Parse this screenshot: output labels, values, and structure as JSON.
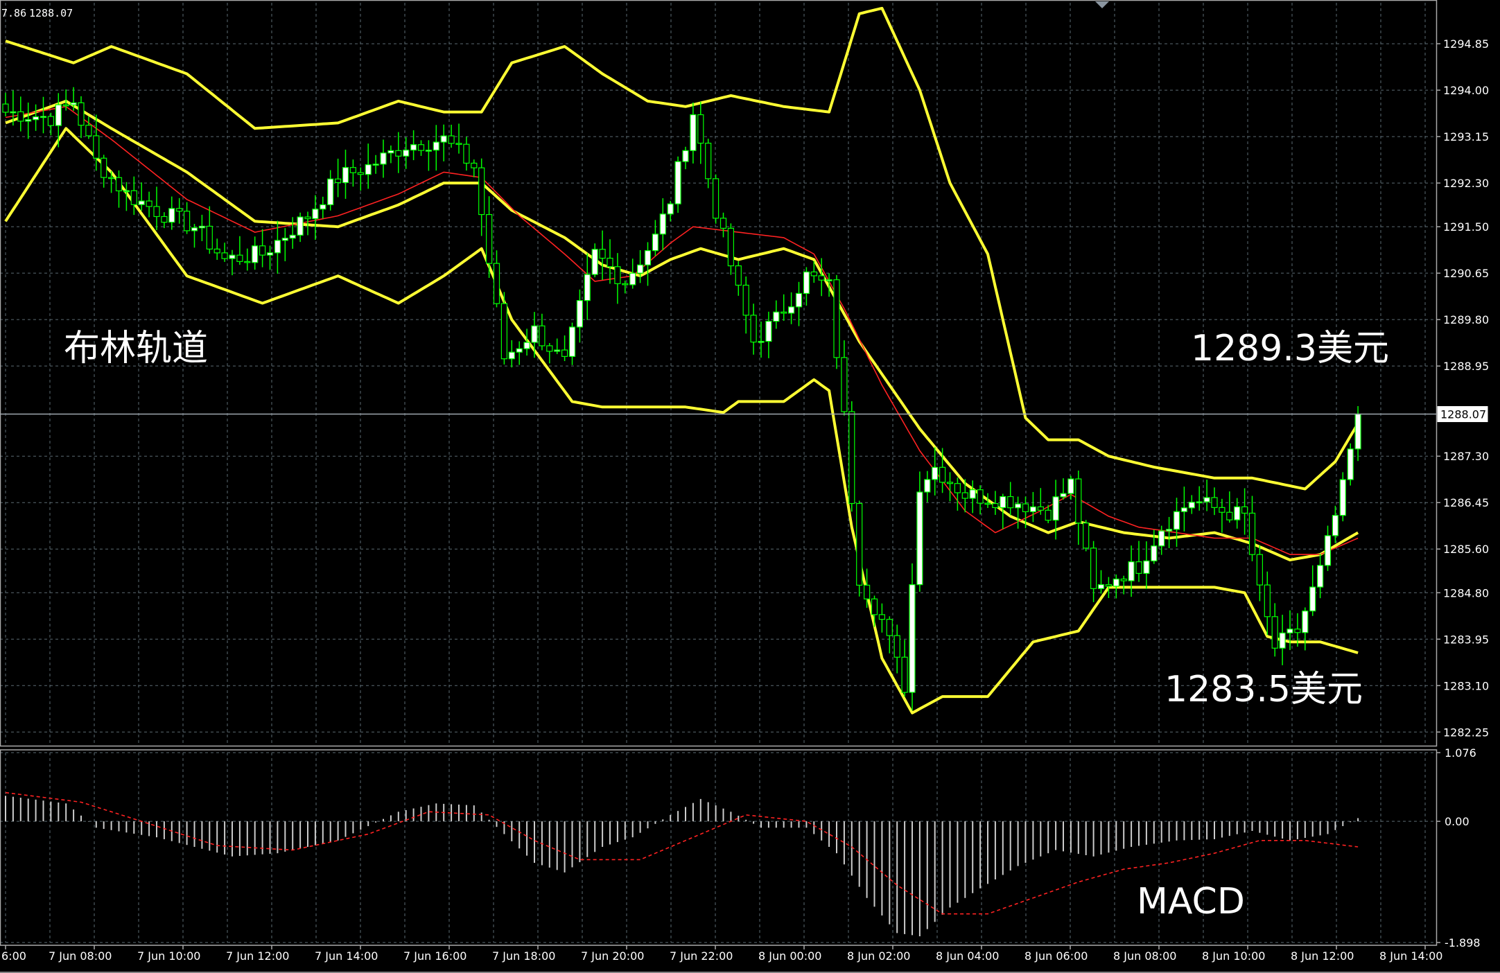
{
  "header": {
    "left_value": "7.86",
    "right_value": "1288.07"
  },
  "annotations": {
    "bollinger": "布林轨道",
    "upper_price": "1289.3美元",
    "lower_price": "1283.5美元",
    "macd": "MACD"
  },
  "colors": {
    "background": "#000000",
    "grid": "#5c6b73",
    "frame": "#aaaaaa",
    "bull_candle": "#ffffff",
    "bear_candle": "#00ff00",
    "bollinger": "#ffff33",
    "ma": "#ff2222",
    "macd_hist": "#cccccc",
    "macd_signal": "#ff2222",
    "current_price_line": "#a0a8b0"
  },
  "chart_data": [
    {
      "type": "candlestick",
      "title": "",
      "current_price": 1288.07,
      "ylim": [
        1282.0,
        1295.6
      ],
      "y_ticks": [
        "1294.85",
        "1294.00",
        "1293.15",
        "1292.30",
        "1291.50",
        "1290.65",
        "1289.80",
        "1288.95",
        "1287.30",
        "1286.45",
        "1285.60",
        "1284.80",
        "1283.95",
        "1283.10",
        "1282.25"
      ],
      "x_ticks": [
        "6:00",
        "7 Jun 08:00",
        "7 Jun 10:00",
        "7 Jun 12:00",
        "7 Jun 14:00",
        "7 Jun 16:00",
        "7 Jun 18:00",
        "7 Jun 20:00",
        "7 Jun 22:00",
        "8 Jun 00:00",
        "8 Jun 02:00",
        "8 Jun 04:00",
        "8 Jun 06:00",
        "8 Jun 08:00",
        "8 Jun 10:00",
        "8 Jun 12:00",
        "8 Jun 14:00"
      ],
      "x_step_hours": 2,
      "candle_count": 180,
      "close_anchors": [
        [
          0,
          1293.6
        ],
        [
          6,
          1293.5
        ],
        [
          9,
          1293.8
        ],
        [
          12,
          1292.7
        ],
        [
          16,
          1292.1
        ],
        [
          20,
          1291.8
        ],
        [
          25,
          1291.5
        ],
        [
          29,
          1290.9
        ],
        [
          34,
          1291.0
        ],
        [
          40,
          1291.7
        ],
        [
          44,
          1292.4
        ],
        [
          48,
          1292.6
        ],
        [
          53,
          1293.0
        ],
        [
          58,
          1293.1
        ],
        [
          62,
          1292.6
        ],
        [
          66,
          1289.1
        ],
        [
          70,
          1289.6
        ],
        [
          74,
          1289.0
        ],
        [
          78,
          1291.0
        ],
        [
          82,
          1290.5
        ],
        [
          86,
          1291.3
        ],
        [
          88,
          1292.0
        ],
        [
          91,
          1293.6
        ],
        [
          94,
          1291.8
        ],
        [
          97,
          1290.3
        ],
        [
          99,
          1289.4
        ],
        [
          102,
          1289.8
        ],
        [
          106,
          1290.6
        ],
        [
          109,
          1290.4
        ],
        [
          111,
          1288.0
        ],
        [
          113,
          1285.1
        ],
        [
          116,
          1284.3
        ],
        [
          119,
          1283.1
        ],
        [
          121,
          1286.8
        ],
        [
          123,
          1287.1
        ],
        [
          127,
          1286.6
        ],
        [
          133,
          1286.5
        ],
        [
          138,
          1286.3
        ],
        [
          141,
          1286.8
        ],
        [
          144,
          1284.8
        ],
        [
          147,
          1285.1
        ],
        [
          150,
          1285.3
        ],
        [
          153,
          1286.0
        ],
        [
          157,
          1286.5
        ],
        [
          161,
          1286.3
        ],
        [
          164,
          1286.2
        ],
        [
          166,
          1284.8
        ],
        [
          168,
          1283.8
        ],
        [
          171,
          1284.1
        ],
        [
          174,
          1285.2
        ],
        [
          177,
          1286.7
        ],
        [
          179,
          1288.07
        ]
      ],
      "bollinger": {
        "upper_anchors": [
          [
            0,
            1294.9
          ],
          [
            9,
            1294.5
          ],
          [
            14,
            1294.8
          ],
          [
            24,
            1294.3
          ],
          [
            33,
            1293.3
          ],
          [
            44,
            1293.4
          ],
          [
            52,
            1293.8
          ],
          [
            58,
            1293.6
          ],
          [
            63,
            1293.6
          ],
          [
            67,
            1294.5
          ],
          [
            74,
            1294.8
          ],
          [
            79,
            1294.3
          ],
          [
            85,
            1293.8
          ],
          [
            90,
            1293.7
          ],
          [
            96,
            1293.9
          ],
          [
            103,
            1293.7
          ],
          [
            109,
            1293.6
          ],
          [
            113,
            1295.4
          ],
          [
            116,
            1295.5
          ],
          [
            121,
            1294.0
          ],
          [
            125,
            1292.3
          ],
          [
            130,
            1291.0
          ],
          [
            135,
            1288.0
          ],
          [
            138,
            1287.6
          ],
          [
            142,
            1287.6
          ],
          [
            146,
            1287.3
          ],
          [
            152,
            1287.1
          ],
          [
            160,
            1286.9
          ],
          [
            165,
            1286.9
          ],
          [
            172,
            1286.7
          ],
          [
            176,
            1287.2
          ],
          [
            179,
            1287.9
          ]
        ],
        "middle_anchors": [
          [
            0,
            1293.4
          ],
          [
            8,
            1293.8
          ],
          [
            14,
            1293.3
          ],
          [
            24,
            1292.5
          ],
          [
            33,
            1291.6
          ],
          [
            44,
            1291.5
          ],
          [
            52,
            1291.9
          ],
          [
            58,
            1292.3
          ],
          [
            63,
            1292.3
          ],
          [
            67,
            1291.8
          ],
          [
            74,
            1291.3
          ],
          [
            79,
            1290.8
          ],
          [
            84,
            1290.6
          ],
          [
            88,
            1290.9
          ],
          [
            92,
            1291.1
          ],
          [
            97,
            1290.9
          ],
          [
            103,
            1291.1
          ],
          [
            107,
            1290.9
          ],
          [
            113,
            1289.4
          ],
          [
            121,
            1287.8
          ],
          [
            127,
            1286.8
          ],
          [
            133,
            1286.2
          ],
          [
            138,
            1285.9
          ],
          [
            142,
            1286.1
          ],
          [
            148,
            1285.9
          ],
          [
            154,
            1285.8
          ],
          [
            160,
            1285.9
          ],
          [
            165,
            1285.7
          ],
          [
            170,
            1285.4
          ],
          [
            174,
            1285.5
          ],
          [
            179,
            1285.9
          ]
        ],
        "lower_anchors": [
          [
            0,
            1291.6
          ],
          [
            8,
            1293.3
          ],
          [
            14,
            1292.5
          ],
          [
            24,
            1290.6
          ],
          [
            34,
            1290.1
          ],
          [
            44,
            1290.6
          ],
          [
            52,
            1290.1
          ],
          [
            58,
            1290.6
          ],
          [
            63,
            1291.1
          ],
          [
            67,
            1289.8
          ],
          [
            75,
            1288.3
          ],
          [
            79,
            1288.2
          ],
          [
            85,
            1288.2
          ],
          [
            90,
            1288.2
          ],
          [
            95,
            1288.1
          ],
          [
            97,
            1288.3
          ],
          [
            103,
            1288.3
          ],
          [
            107,
            1288.7
          ],
          [
            109,
            1288.5
          ],
          [
            112,
            1286.0
          ],
          [
            116,
            1283.6
          ],
          [
            120,
            1282.6
          ],
          [
            124,
            1282.9
          ],
          [
            130,
            1282.9
          ],
          [
            136,
            1283.9
          ],
          [
            142,
            1284.1
          ],
          [
            146,
            1284.9
          ],
          [
            150,
            1284.9
          ],
          [
            160,
            1284.9
          ],
          [
            164,
            1284.8
          ],
          [
            167,
            1284.0
          ],
          [
            170,
            1283.9
          ],
          [
            174,
            1283.9
          ],
          [
            179,
            1283.7
          ]
        ]
      },
      "ma_anchors": [
        [
          0,
          1293.5
        ],
        [
          8,
          1293.7
        ],
        [
          14,
          1293.1
        ],
        [
          24,
          1292.0
        ],
        [
          33,
          1291.4
        ],
        [
          44,
          1291.7
        ],
        [
          52,
          1292.1
        ],
        [
          58,
          1292.5
        ],
        [
          63,
          1292.4
        ],
        [
          68,
          1291.7
        ],
        [
          74,
          1291.0
        ],
        [
          78,
          1290.5
        ],
        [
          83,
          1290.6
        ],
        [
          88,
          1291.2
        ],
        [
          91,
          1291.5
        ],
        [
          97,
          1291.4
        ],
        [
          103,
          1291.3
        ],
        [
          107,
          1291.0
        ],
        [
          111,
          1290.0
        ],
        [
          116,
          1288.6
        ],
        [
          121,
          1287.4
        ],
        [
          127,
          1286.3
        ],
        [
          131,
          1285.9
        ],
        [
          137,
          1286.3
        ],
        [
          141,
          1286.6
        ],
        [
          146,
          1286.2
        ],
        [
          150,
          1286.0
        ],
        [
          155,
          1285.9
        ],
        [
          160,
          1285.8
        ],
        [
          165,
          1285.8
        ],
        [
          170,
          1285.5
        ],
        [
          174,
          1285.5
        ],
        [
          179,
          1285.8
        ]
      ]
    },
    {
      "type": "macd",
      "title": "",
      "ylim": [
        -1.898,
        1.076
      ],
      "y_ticks": [
        "1.076",
        "0.00",
        "-1.898"
      ],
      "histogram_anchors": [
        [
          0,
          0.4
        ],
        [
          8,
          0.28
        ],
        [
          12,
          -0.1
        ],
        [
          20,
          -0.25
        ],
        [
          30,
          -0.55
        ],
        [
          36,
          -0.5
        ],
        [
          44,
          -0.3
        ],
        [
          52,
          0.15
        ],
        [
          57,
          0.28
        ],
        [
          62,
          0.25
        ],
        [
          66,
          -0.2
        ],
        [
          70,
          -0.65
        ],
        [
          74,
          -0.8
        ],
        [
          79,
          -0.4
        ],
        [
          83,
          -0.25
        ],
        [
          88,
          0.1
        ],
        [
          92,
          0.35
        ],
        [
          96,
          0.15
        ],
        [
          100,
          -0.1
        ],
        [
          106,
          -0.1
        ],
        [
          110,
          -0.5
        ],
        [
          114,
          -1.2
        ],
        [
          118,
          -1.75
        ],
        [
          121,
          -1.8
        ],
        [
          125,
          -1.35
        ],
        [
          129,
          -1.05
        ],
        [
          134,
          -0.7
        ],
        [
          139,
          -0.45
        ],
        [
          144,
          -0.55
        ],
        [
          149,
          -0.4
        ],
        [
          155,
          -0.3
        ],
        [
          160,
          -0.28
        ],
        [
          165,
          -0.15
        ],
        [
          170,
          -0.3
        ],
        [
          175,
          -0.2
        ],
        [
          179,
          0.05
        ]
      ],
      "signal_anchors": [
        [
          0,
          0.45
        ],
        [
          10,
          0.3
        ],
        [
          18,
          0.0
        ],
        [
          28,
          -0.38
        ],
        [
          38,
          -0.45
        ],
        [
          48,
          -0.2
        ],
        [
          56,
          0.15
        ],
        [
          64,
          0.1
        ],
        [
          70,
          -0.3
        ],
        [
          76,
          -0.6
        ],
        [
          84,
          -0.6
        ],
        [
          92,
          -0.2
        ],
        [
          98,
          0.1
        ],
        [
          106,
          0.0
        ],
        [
          112,
          -0.4
        ],
        [
          118,
          -1.0
        ],
        [
          124,
          -1.45
        ],
        [
          130,
          -1.45
        ],
        [
          136,
          -1.2
        ],
        [
          142,
          -0.95
        ],
        [
          148,
          -0.75
        ],
        [
          154,
          -0.65
        ],
        [
          160,
          -0.5
        ],
        [
          166,
          -0.3
        ],
        [
          172,
          -0.3
        ],
        [
          179,
          -0.4
        ]
      ]
    }
  ]
}
